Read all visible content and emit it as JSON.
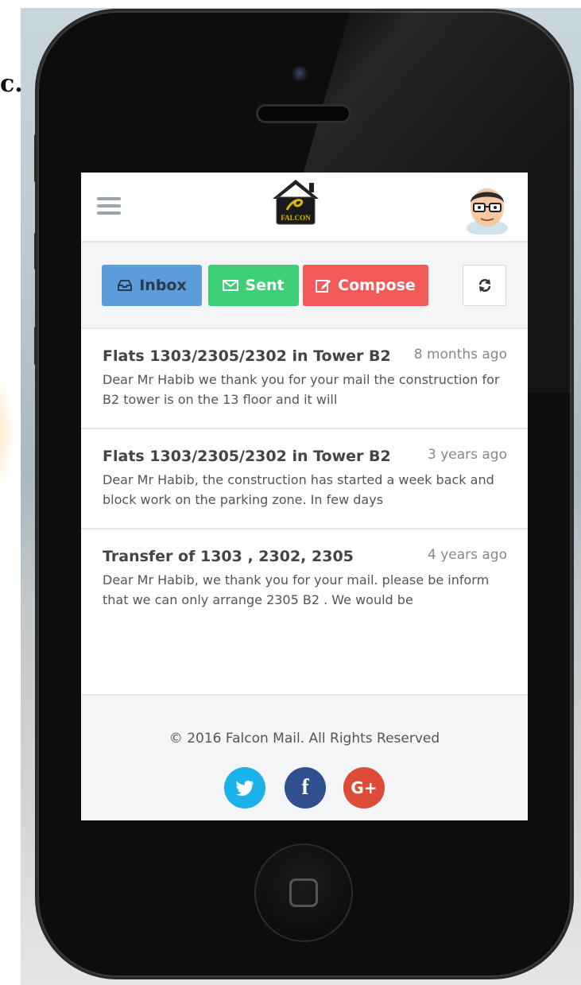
{
  "page_edge_text": "c.",
  "app": {
    "logo_text": "FALCON",
    "toolbar": {
      "inbox_label": "Inbox",
      "sent_label": "Sent",
      "compose_label": "Compose"
    },
    "mails": [
      {
        "subject": "Flats 1303/2305/2302 in Tower B2",
        "time": "8 months ago",
        "preview": "Dear Mr Habib we thank you for your mail the construction for B2 tower is on the 13 floor and it will"
      },
      {
        "subject": "Flats 1303/2305/2302 in Tower B2",
        "time": "3 years ago",
        "preview": "Dear Mr Habib, the construction has started a week back and block work on the parking zone. In few days"
      },
      {
        "subject": "Transfer of 1303 , 2302, 2305",
        "time": "4 years ago",
        "preview": "Dear Mr Habib, we thank you for your mail. please be inform that we can only arrange 2305 B2 . We would be"
      }
    ],
    "footer": {
      "copyright": "© 2016 Falcon Mail. All Rights Reserved",
      "social": [
        {
          "name": "twitter",
          "glyph": ""
        },
        {
          "name": "facebook",
          "glyph": "f"
        },
        {
          "name": "google-plus",
          "glyph": "G+"
        }
      ]
    }
  },
  "colors": {
    "inbox": "#5d9cdb",
    "sent": "#3ecf77",
    "compose": "#f25a5a",
    "twitter": "#1ab2e8",
    "facebook": "#2f4f8f",
    "google_plus": "#dd4b39"
  }
}
